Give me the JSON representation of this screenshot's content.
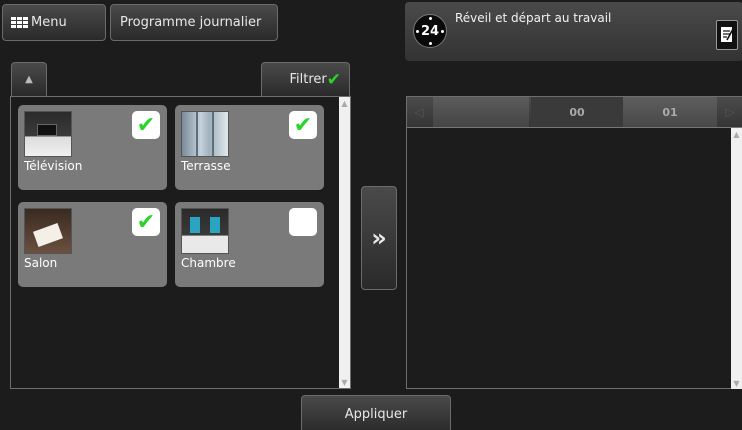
{
  "top_bar": {
    "menu_label": "Menu",
    "programme_label": "Programme journalier"
  },
  "header": {
    "clock_text": "24",
    "scenario_title": "Réveil et départ au travail"
  },
  "filter": {
    "label": "Filtrer"
  },
  "rooms": [
    {
      "label": "Télévision",
      "checked": true
    },
    {
      "label": "Terrasse",
      "checked": true
    },
    {
      "label": "Salon",
      "checked": true
    },
    {
      "label": "Chambre",
      "checked": false
    }
  ],
  "timeline": {
    "hours": [
      "00",
      "01"
    ]
  },
  "footer": {
    "apply_label": "Appliquer"
  },
  "colors": {
    "check_green": "#2bd42b",
    "card_grey": "#7a7a7a"
  }
}
